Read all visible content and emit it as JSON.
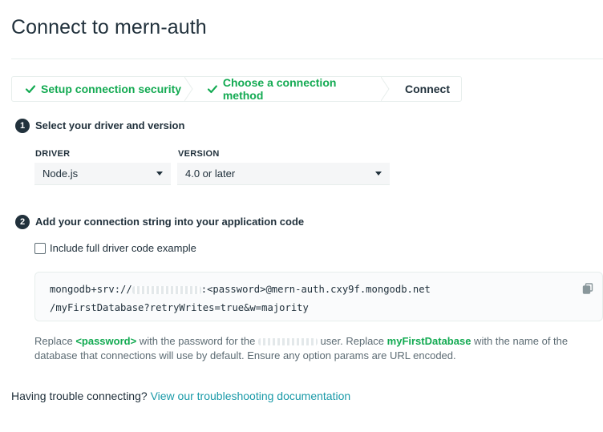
{
  "page": {
    "title": "Connect to mern-auth"
  },
  "steps": [
    {
      "label": "Setup connection security",
      "state": "done"
    },
    {
      "label": "Choose a connection method",
      "state": "done"
    },
    {
      "label": "Connect",
      "state": "current"
    }
  ],
  "section1": {
    "number": "1",
    "title": "Select your driver and version",
    "driver_label": "DRIVER",
    "driver_value": "Node.js",
    "version_label": "VERSION",
    "version_value": "4.0 or later"
  },
  "section2": {
    "number": "2",
    "title": "Add your connection string into your application code",
    "checkbox_label": "Include full driver code example",
    "checkbox_checked": false,
    "code_line1_prefix": "mongodb+srv://",
    "code_line1_suffix": ":<password>@mern-auth.cxy9f.mongodb.net",
    "code_line2": "/myFirstDatabase?retryWrites=true&w=majority",
    "note_part1": "Replace ",
    "note_password": "<password>",
    "note_part2": " with the password for the ",
    "note_part3": " user. Replace ",
    "note_db": "myFirstDatabase",
    "note_part4": " with the name of the database that connections will use by default. Ensure any option params are URL encoded."
  },
  "footer": {
    "question": "Having trouble connecting? ",
    "link": "View our troubleshooting documentation"
  },
  "colors": {
    "accent_green": "#13aa52",
    "text_dark": "#21313c",
    "text_muted": "#5d6c74",
    "link": "#1a9aa8"
  },
  "icons": {
    "step_done": "check-icon",
    "dropdown": "caret-down-icon",
    "copy": "copy-icon"
  }
}
